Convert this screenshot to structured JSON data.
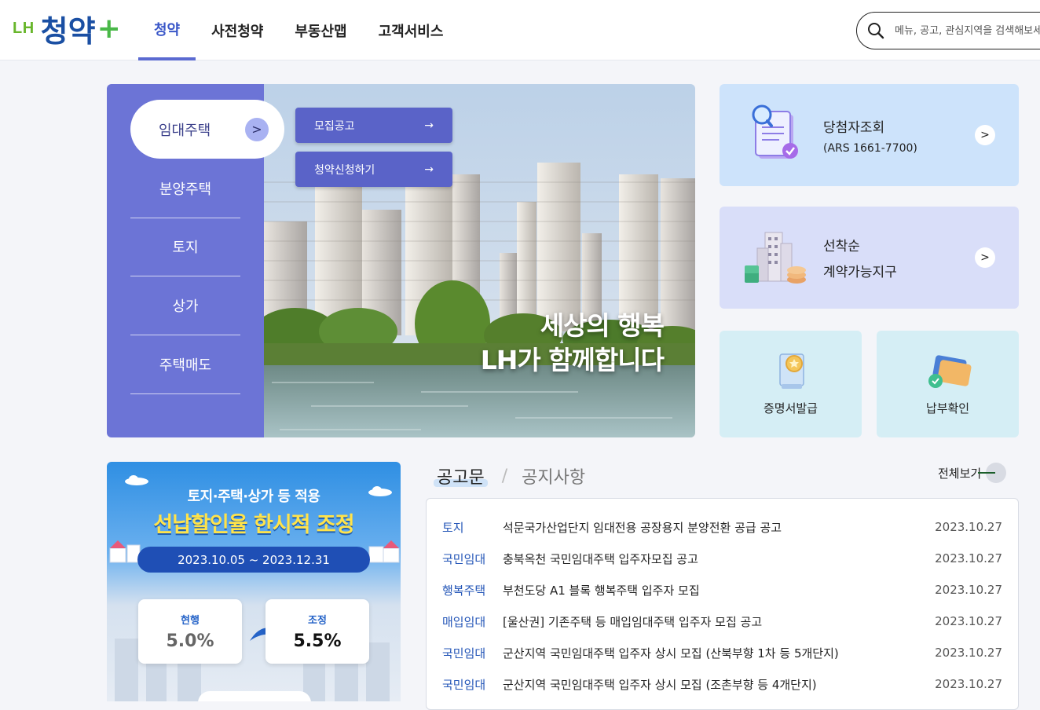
{
  "header": {
    "logo_lh": "LH",
    "logo_main": "청약",
    "logo_plus": "+",
    "nav": [
      "청약",
      "사전청약",
      "부동산맵",
      "고객서비스"
    ],
    "search_placeholder": "메뉴, 공고, 관심지역을 검색해보세요"
  },
  "hero": {
    "menu": [
      "임대주택",
      "분양주택",
      "토지",
      "상가",
      "주택매도"
    ],
    "active_menu": "임대주택",
    "sub_buttons": [
      "모집공고",
      "청약신청하기"
    ],
    "headline_1": "세상의 행복",
    "headline_2": "LH가 함께합니다"
  },
  "cards": {
    "winner": {
      "title": "당첨자조회",
      "sub": "(ARS 1661-7700)"
    },
    "firstcome": {
      "line1": "선착순",
      "line2": "계약가능지구"
    },
    "cert": "증명서발급",
    "payment": "납부확인"
  },
  "promo": {
    "line1": "토지·주택·상가 등 적용",
    "line2": "선납할인율 한시적 조정",
    "date": "2023.10.05 ~ 2023.12.31",
    "current_label": "현행",
    "current_value": "5.0%",
    "adjusted_label": "조정",
    "adjusted_value": "5.5%"
  },
  "notices": {
    "tab_active": "공고문",
    "tab_sep": "/",
    "tab_other": "공지사항",
    "view_all": "전체보기",
    "rows": [
      {
        "category": "토지",
        "title": "석문국가산업단지 임대전용 공장용지 분양전환 공급 공고",
        "date": "2023.10.27"
      },
      {
        "category": "국민임대",
        "title": "충북옥천 국민임대주택 입주자모집 공고",
        "date": "2023.10.27"
      },
      {
        "category": "행복주택",
        "title": "부천도당 A1 블록 행복주택 입주자 모집",
        "date": "2023.10.27"
      },
      {
        "category": "매입임대",
        "title": "[울산권] 기존주택 등 매입임대주택 입주자 모집 공고",
        "date": "2023.10.27"
      },
      {
        "category": "국민임대",
        "title": "군산지역 국민임대주택 입주자 상시 모집 (산북부향 1차 등 5개단지)",
        "date": "2023.10.27"
      },
      {
        "category": "국민임대",
        "title": "군산지역 국민임대주택 입주자 상시 모집 (조촌부향 등 4개단지)",
        "date": "2023.10.27"
      }
    ]
  },
  "colors": {
    "accent": "#5b6ad1",
    "menu_bg": "#6c74d6",
    "card_blue": "#cde3fb",
    "card_lavender": "#d9def9",
    "card_mint": "#d5eef5"
  }
}
